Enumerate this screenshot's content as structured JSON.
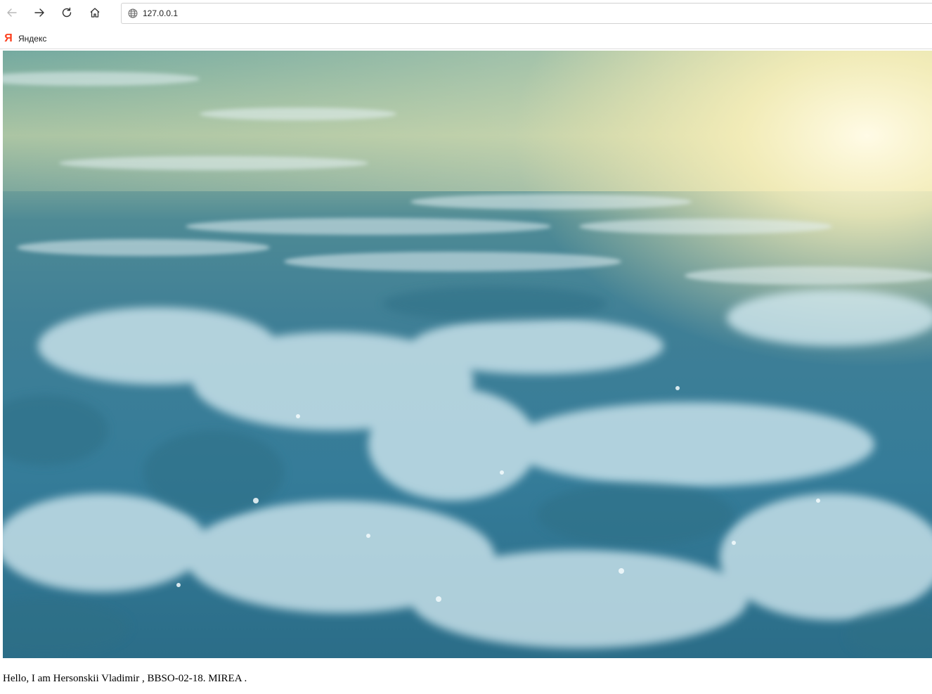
{
  "browser": {
    "address": {
      "url": "127.0.0.1"
    },
    "bookmarks": [
      {
        "label": "Яндекс",
        "icon": "yandex-logo-icon",
        "logo_text": "Я"
      }
    ],
    "icons": [
      "back-arrow-icon",
      "forward-arrow-icon",
      "reload-icon",
      "home-icon",
      "globe-icon"
    ]
  },
  "page": {
    "image": {
      "subject": "sea-waves-photo"
    },
    "caption": "Hello, I am Hersonskii Vladimir , BBSO-02-18. MIREA ."
  },
  "colors": {
    "yandex_red": "#fc3f1d",
    "water_dark": "#2f6f86",
    "water_light": "#9fd0df",
    "sunlight": "#fbf3c4"
  }
}
